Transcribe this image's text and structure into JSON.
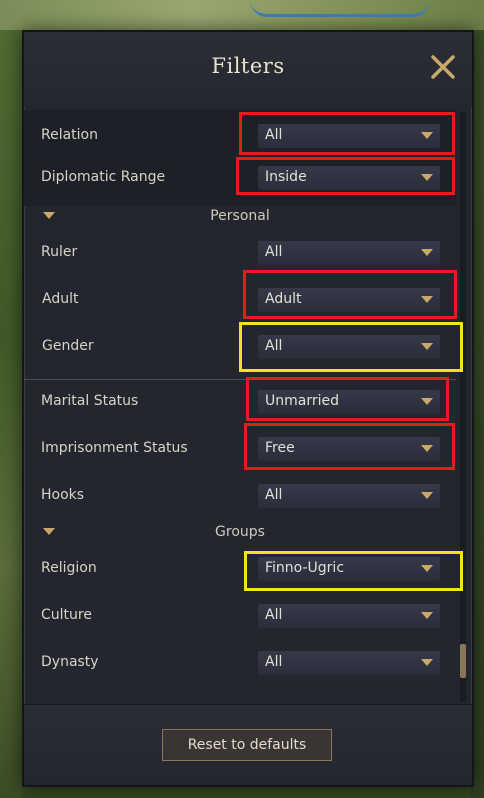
{
  "dialog": {
    "title": "Filters",
    "close_icon": "close-icon"
  },
  "rows": {
    "relation": {
      "label": "Relation",
      "value": "All"
    },
    "diplomatic_range": {
      "label": "Diplomatic Range",
      "value": "Inside"
    },
    "ruler": {
      "label": "Ruler",
      "value": "All"
    },
    "adult": {
      "label": "Adult",
      "value": "Adult"
    },
    "gender": {
      "label": "Gender",
      "value": "All"
    },
    "marital_status": {
      "label": "Marital Status",
      "value": "Unmarried"
    },
    "imprisonment_status": {
      "label": "Imprisonment Status",
      "value": "Free"
    },
    "hooks": {
      "label": "Hooks",
      "value": "All"
    },
    "religion": {
      "label": "Religion",
      "value": "Finno-Ugric"
    },
    "culture": {
      "label": "Culture",
      "value": "All"
    },
    "dynasty": {
      "label": "Dynasty",
      "value": "All"
    }
  },
  "sections": {
    "personal": "Personal",
    "groups": "Groups"
  },
  "footer": {
    "reset_label": "Reset to defaults"
  },
  "colors": {
    "highlight_red": "#e31d1d",
    "highlight_yellow": "#f3e41a",
    "accent_gold": "#c9a86a"
  }
}
